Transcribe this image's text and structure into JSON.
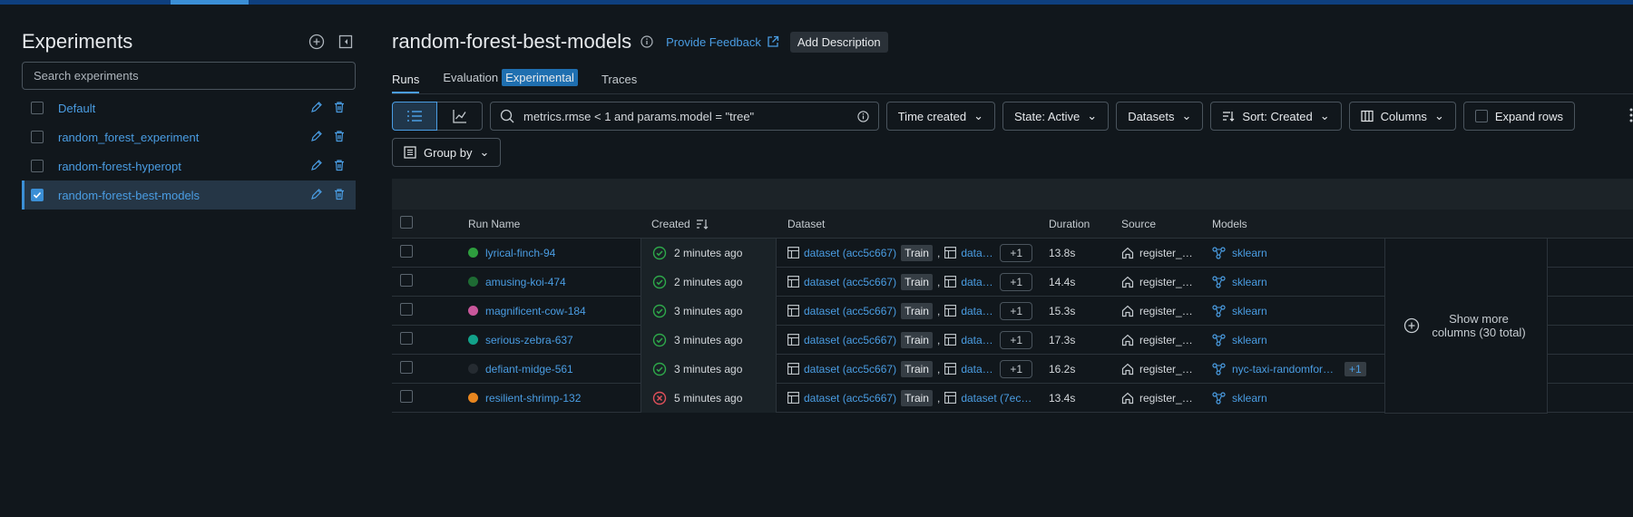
{
  "sidebar": {
    "title": "Experiments",
    "search_placeholder": "Search experiments",
    "experiments": [
      {
        "name": "Default",
        "selected": false
      },
      {
        "name": "random_forest_experiment",
        "selected": false
      },
      {
        "name": "random-forest-hyperopt",
        "selected": false
      },
      {
        "name": "random-forest-best-models",
        "selected": true
      }
    ]
  },
  "header": {
    "title": "random-forest-best-models",
    "feedback": "Provide Feedback",
    "add_description": "Add Description"
  },
  "tabs": [
    {
      "label": "Runs",
      "active": true
    },
    {
      "label": "Evaluation",
      "badge": "Experimental"
    },
    {
      "label": "Traces"
    }
  ],
  "toolbar": {
    "search_value": "metrics.rmse < 1 and params.model = \"tree\"",
    "time_created": "Time created",
    "state": "State: Active",
    "datasets": "Datasets",
    "sort": "Sort: Created",
    "columns": "Columns",
    "expand_rows": "Expand rows",
    "group_by": "Group by"
  },
  "table": {
    "headers": {
      "run_name": "Run Name",
      "created": "Created",
      "dataset": "Dataset",
      "duration": "Duration",
      "source": "Source",
      "models": "Models"
    },
    "rows": [
      {
        "name": "lyrical-finch-94",
        "color": "#2e9e3e",
        "status": "success",
        "created": "2 minutes ago",
        "dataset": "dataset (acc5c667)",
        "tag": "Train",
        "dataset2": "datas…",
        "more": "+1",
        "duration": "13.8s",
        "source": "register_…",
        "model": "sklearn"
      },
      {
        "name": "amusing-koi-474",
        "color": "#1e6b33",
        "status": "success",
        "created": "2 minutes ago",
        "dataset": "dataset (acc5c667)",
        "tag": "Train",
        "dataset2": "datas…",
        "more": "+1",
        "duration": "14.4s",
        "source": "register_…",
        "model": "sklearn"
      },
      {
        "name": "magnificent-cow-184",
        "color": "#c9579b",
        "status": "success",
        "created": "3 minutes ago",
        "dataset": "dataset (acc5c667)",
        "tag": "Train",
        "dataset2": "datas…",
        "more": "+1",
        "duration": "15.3s",
        "source": "register_…",
        "model": "sklearn"
      },
      {
        "name": "serious-zebra-637",
        "color": "#12a28a",
        "status": "success",
        "created": "3 minutes ago",
        "dataset": "dataset (acc5c667)",
        "tag": "Train",
        "dataset2": "datas…",
        "more": "+1",
        "duration": "17.3s",
        "source": "register_…",
        "model": "sklearn"
      },
      {
        "name": "defiant-midge-561",
        "color": "#252b31",
        "status": "success",
        "created": "3 minutes ago",
        "dataset": "dataset (acc5c667)",
        "tag": "Train",
        "dataset2": "datas…",
        "more": "+1",
        "duration": "16.2s",
        "source": "register_…",
        "model": "nyc-taxi-randomfore…",
        "model_more": "+1"
      },
      {
        "name": "resilient-shrimp-132",
        "color": "#e8861f",
        "status": "failed",
        "created": "5 minutes ago",
        "dataset": "dataset (acc5c667)",
        "tag": "Train",
        "dataset2": "dataset (7ec…",
        "more": "",
        "duration": "13.4s",
        "source": "register_…",
        "model": "sklearn"
      }
    ],
    "show_more": "Show more columns (30 total)"
  },
  "colors": {
    "accent": "#4a9de3",
    "success": "#2ea84a",
    "failed": "#e0505a"
  }
}
